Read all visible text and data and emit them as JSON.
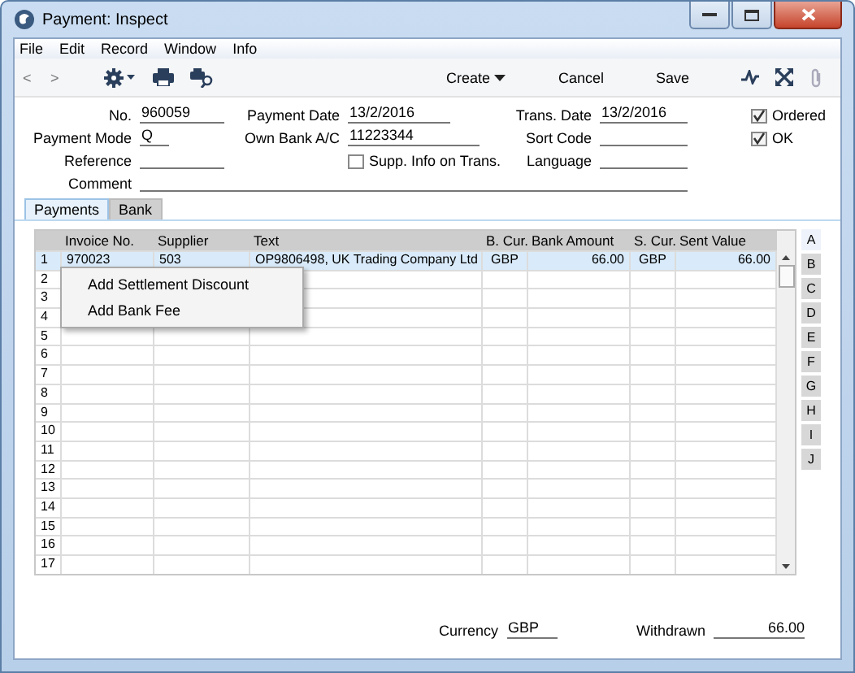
{
  "window": {
    "title": "Payment: Inspect"
  },
  "menu_bar": [
    "File",
    "Edit",
    "Record",
    "Window",
    "Info"
  ],
  "toolbar": {
    "prev": "<",
    "next": ">",
    "actions": [
      "Create",
      "Cancel",
      "Save"
    ]
  },
  "form": {
    "no": {
      "label": "No.",
      "value": "960059"
    },
    "payment_date": {
      "label": "Payment Date",
      "value": "13/2/2016"
    },
    "trans_date": {
      "label": "Trans. Date",
      "value": "13/2/2016"
    },
    "ordered": {
      "label": "Ordered",
      "checked": true
    },
    "payment_mode": {
      "label": "Payment Mode",
      "value": "Q"
    },
    "own_bank": {
      "label": "Own Bank A/C",
      "value": "11223344"
    },
    "sort_code": {
      "label": "Sort Code"
    },
    "ok": {
      "label": "OK",
      "checked": true
    },
    "reference": {
      "label": "Reference"
    },
    "supp_info": {
      "label": "Supp. Info on Trans.",
      "checked": false
    },
    "language": {
      "label": "Language"
    },
    "comment": {
      "label": "Comment"
    }
  },
  "tabs": [
    {
      "label": "Payments",
      "selected": true
    },
    {
      "label": "Bank",
      "selected": false
    }
  ],
  "table": {
    "columns": [
      "Invoice No.",
      "Supplier",
      "Text",
      "B. Cur.",
      "Bank Amount",
      "S. Cur.",
      "Sent Value"
    ],
    "rows": [
      {
        "number": "1",
        "selected": true,
        "cells": [
          "970023",
          "503",
          "OP9806498, UK Trading Company Ltd",
          "GBP",
          "66.00",
          "GBP",
          "66.00"
        ]
      },
      {
        "number": "2",
        "selected": false
      },
      {
        "number": "3",
        "selected": false
      },
      {
        "number": "4",
        "selected": false
      },
      {
        "number": "5",
        "selected": false
      },
      {
        "number": "6",
        "selected": false
      },
      {
        "number": "7",
        "selected": false
      },
      {
        "number": "8",
        "selected": false
      },
      {
        "number": "9",
        "selected": false
      },
      {
        "number": "10",
        "selected": false
      },
      {
        "number": "11",
        "selected": false
      },
      {
        "number": "12",
        "selected": false
      },
      {
        "number": "13",
        "selected": false
      },
      {
        "number": "14",
        "selected": false
      },
      {
        "number": "15",
        "selected": false
      },
      {
        "number": "16",
        "selected": false
      },
      {
        "number": "17",
        "selected": false
      }
    ]
  },
  "side_tabs": [
    {
      "label": "A",
      "selected": true
    },
    {
      "label": "B",
      "selected": false
    },
    {
      "label": "C",
      "selected": false
    },
    {
      "label": "D",
      "selected": false
    },
    {
      "label": "E",
      "selected": false
    },
    {
      "label": "F",
      "selected": false
    },
    {
      "label": "G",
      "selected": false
    },
    {
      "label": "H",
      "selected": false
    },
    {
      "label": "I",
      "selected": false
    },
    {
      "label": "J",
      "selected": false
    }
  ],
  "context_menu": [
    "Add Settlement Discount",
    "Add Bank Fee"
  ],
  "footer": {
    "currency": {
      "label": "Currency",
      "value": "GBP"
    },
    "withdrawn": {
      "label": "Withdrawn",
      "value": "66.00"
    }
  }
}
